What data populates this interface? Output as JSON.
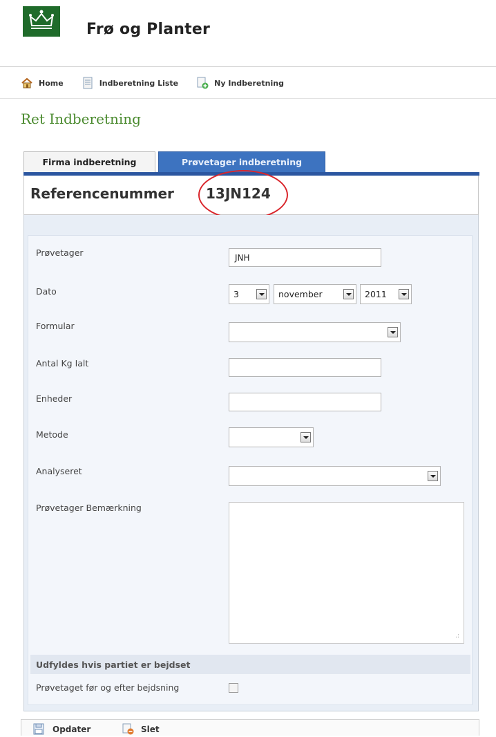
{
  "header": {
    "app_title": "Frø og Planter"
  },
  "nav": [
    {
      "label": "Home",
      "icon": "home-icon"
    },
    {
      "label": "Indberetning Liste",
      "icon": "list-document-icon"
    },
    {
      "label": "Ny Indberetning",
      "icon": "new-document-icon"
    }
  ],
  "page": {
    "title": "Ret Indberetning"
  },
  "tabs": [
    {
      "label": "Firma indberetning",
      "active": false
    },
    {
      "label": "Prøvetager indberetning",
      "active": true
    }
  ],
  "reference": {
    "label": "Referencenummer",
    "value": "13JN124",
    "highlight_color": "#d9252b"
  },
  "form": {
    "provetager": {
      "label": "Prøvetager",
      "value": "JNH"
    },
    "dato": {
      "label": "Dato",
      "day": "3",
      "month": "november",
      "year": "2011"
    },
    "formular": {
      "label": "Formular",
      "value": ""
    },
    "antal_kg": {
      "label": "Antal Kg Ialt",
      "value": ""
    },
    "enheder": {
      "label": "Enheder",
      "value": ""
    },
    "metode": {
      "label": "Metode",
      "value": ""
    },
    "analyseret": {
      "label": "Analyseret",
      "value": ""
    },
    "bemaerkning": {
      "label": "Prøvetager Bemærkning",
      "value": ""
    },
    "section_title": "Udfyldes hvis partiet er bejdset",
    "bejdsning": {
      "label": "Prøvetaget før og efter bejdsning",
      "checked": false
    }
  },
  "footer": {
    "update_label": "Opdater",
    "delete_label": "Slet"
  },
  "colors": {
    "accent_tab": "#3d73c0",
    "title_green": "#4a8a2e",
    "panel_bg": "#e8eef6"
  }
}
